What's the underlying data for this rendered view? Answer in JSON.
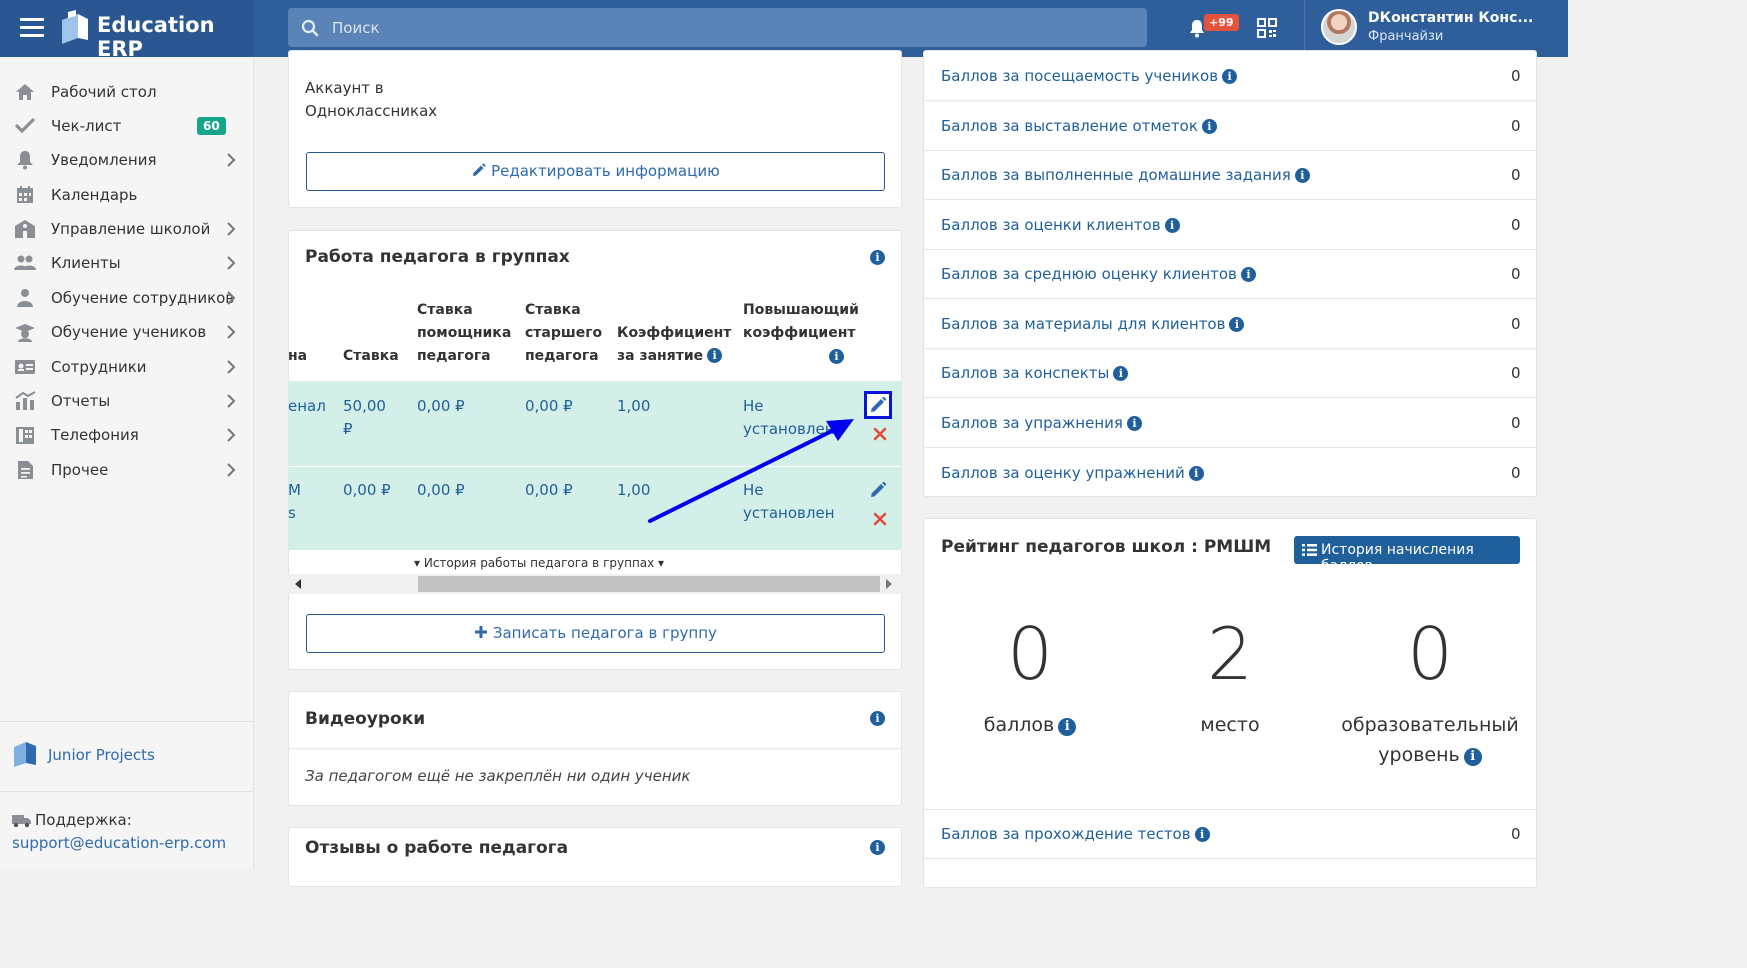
{
  "app": {
    "title": "Education ERP"
  },
  "search": {
    "placeholder": "Поиск"
  },
  "header": {
    "notifications_badge": "+99",
    "user_name": "DКонстантин Конс...",
    "user_role": "Франчайзи"
  },
  "sidebar": {
    "items": [
      {
        "label": "Рабочий стол",
        "icon": "home-icon"
      },
      {
        "label": "Чек-лист",
        "icon": "check-icon",
        "badge": "60"
      },
      {
        "label": "Уведомления",
        "icon": "bell-icon"
      },
      {
        "label": "Календарь",
        "icon": "calendar-icon"
      },
      {
        "label": "Управление школой",
        "icon": "school-icon"
      },
      {
        "label": "Клиенты",
        "icon": "users-icon"
      },
      {
        "label": "Обучение сотрудников",
        "icon": "user-tie-icon"
      },
      {
        "label": "Обучение учеников",
        "icon": "graduation-cap-icon"
      },
      {
        "label": "Сотрудники",
        "icon": "id-card-icon"
      },
      {
        "label": "Отчеты",
        "icon": "chart-icon"
      },
      {
        "label": "Телефония",
        "icon": "phone-book-icon"
      },
      {
        "label": "Прочее",
        "icon": "document-icon"
      }
    ],
    "footer_brand": "Junior Projects",
    "support_label": "Поддержка:",
    "support_email": "support@education-erp.com"
  },
  "profile_card": {
    "account_line1": "Аккаунт в",
    "account_line2": "Одноклассниках",
    "edit_button": "Редактировать информацию"
  },
  "groups_card": {
    "title": "Работа педагога в группах",
    "columns": {
      "c0": "на",
      "rate": "Ставка",
      "assistant_1": "Ставка",
      "assistant_2": "помощника",
      "assistant_3": "педагога",
      "senior_1": "Ставка",
      "senior_2": "старшего",
      "senior_3": "педагога",
      "coef_1": "Коэффициент",
      "coef_2": "за занятие",
      "boost_1": "Повышающий",
      "boost_2": "коэффициент"
    },
    "rows": [
      {
        "c0_line1": "енал",
        "c0_line2": "",
        "rate_line1": "50,00",
        "rate_line2": "₽",
        "assistant": "0,00 ₽",
        "senior": "0,00 ₽",
        "coef": "1,00",
        "boost_line1": "Не",
        "boost_line2": "установлен"
      },
      {
        "c0_line1": "М",
        "c0_line2": "s",
        "rate_line1": "0,00 ₽",
        "rate_line2": "",
        "assistant": "0,00 ₽",
        "senior": "0,00 ₽",
        "coef": "1,00",
        "boost_line1": "Не",
        "boost_line2": "установлен"
      }
    ],
    "history_toggle": "▾ История работы педагога в группах ▾",
    "add_button": "Записать педагога в группу"
  },
  "video_card": {
    "title": "Видеоуроки",
    "empty": "За педагогом ещё не закреплён ни один ученик"
  },
  "reviews_card": {
    "title": "Отзывы о работе педагога"
  },
  "scores": [
    {
      "label": "Баллов за посещаемость учеников",
      "value": "0"
    },
    {
      "label": "Баллов за выставление отметок",
      "value": "0"
    },
    {
      "label": "Баллов за выполненные домашние задания",
      "value": "0"
    },
    {
      "label": "Баллов за оценки клиентов",
      "value": "0"
    },
    {
      "label": "Баллов за среднюю оценку клиентов",
      "value": "0"
    },
    {
      "label": "Баллов за материалы для клиентов",
      "value": "0"
    },
    {
      "label": "Баллов за конспекты",
      "value": "0"
    },
    {
      "label": "Баллов за упражнения",
      "value": "0"
    },
    {
      "label": "Баллов за оценку упражнений",
      "value": "0"
    }
  ],
  "rating_card": {
    "title": "Рейтинг педагогов школ : РМШМ",
    "history_button": "История начисления баллов",
    "points_value": "0",
    "points_label": "баллов",
    "place_value": "2",
    "place_label": "место",
    "level_value": "0",
    "level_label_1": "образовательный",
    "level_label_2": "уровень",
    "tests_label": "Баллов за прохождение тестов",
    "tests_value": "0"
  },
  "colors": {
    "header": "#2e5f9a",
    "brand": "#2a5791",
    "accent": "#1f5f9c",
    "row_highlight": "#d4efe8",
    "badge_green": "#17a589",
    "danger": "#e5533d",
    "annotation_arrow": "#0000ee"
  }
}
